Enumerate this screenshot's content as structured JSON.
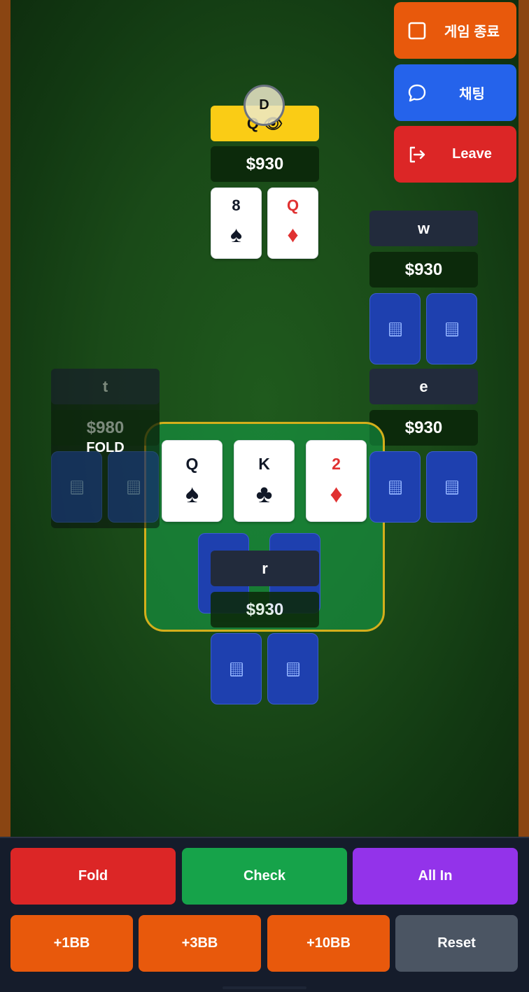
{
  "controls": {
    "end_game": "게임 종료",
    "chat": "채팅",
    "leave": "Leave"
  },
  "dealer_button": "D",
  "players": {
    "top": {
      "name": "Q 👁",
      "stack": "$930",
      "hole_cards": [
        {
          "rank": "8",
          "suit": "♠"
        },
        {
          "rank": "Q",
          "suit": "♦"
        }
      ]
    },
    "right_upper": {
      "name": "w",
      "stack": "$930"
    },
    "right_lower": {
      "name": "e",
      "stack": "$930"
    },
    "left": {
      "name": "t",
      "stack": "$980",
      "status": "FOLD"
    },
    "bottom": {
      "name": "r",
      "stack": "$930"
    }
  },
  "board": [
    {
      "rank": "Q",
      "suit": "♠"
    },
    {
      "rank": "K",
      "suit": "♣"
    },
    {
      "rank": "2",
      "suit": "♦"
    }
  ],
  "actions": {
    "fold": "Fold",
    "check": "Check",
    "all_in": "All In",
    "plus_1bb": "+1BB",
    "plus_3bb": "+3BB",
    "plus_10bb": "+10BB",
    "reset": "Reset"
  },
  "colors": {
    "felt": "#1a4a18",
    "rail": "#8a4512",
    "end_game": "#e8590c",
    "chat": "#2563eb",
    "leave": "#dc2626",
    "active_player": "#facc15",
    "fold": "#dc2626",
    "check": "#16a34a",
    "all_in": "#9333ea",
    "raise": "#e8590c",
    "reset": "#4b5563"
  }
}
